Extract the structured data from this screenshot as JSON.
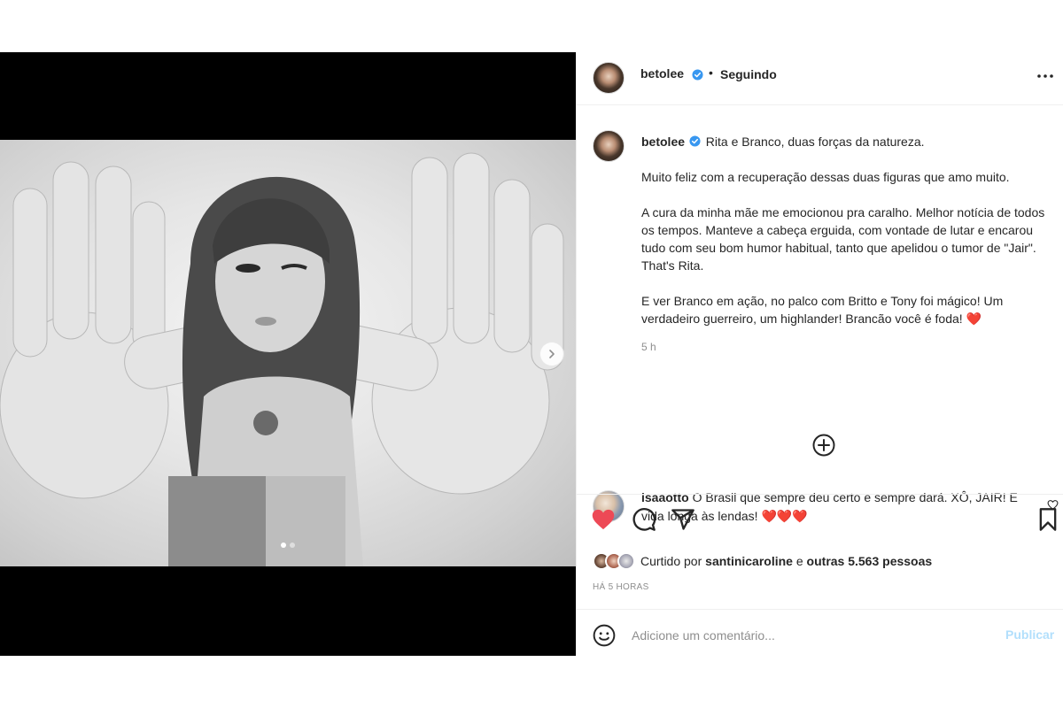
{
  "post": {
    "author": {
      "username": "betolee",
      "verified": true,
      "follow_separator": "•",
      "follow_status": "Seguindo"
    },
    "caption": {
      "headline": "Rita e Branco, duas forças da natureza.",
      "paragraphs": [
        "Muito feliz com a recuperação dessas duas figuras que amo muito.",
        "A cura da minha mãe me emocionou pra caralho. Melhor notícia de todos os tempos. Manteve a cabeça erguida, com vontade de lutar e encarou tudo com seu bom humor habitual, tanto que apelidou o tumor de \"Jair\". That's Rita.",
        "E ver Branco em ação, no palco com Britto e Tony foi mágico! Um verdadeiro guerreiro, um highlander! Brancão você é foda!"
      ],
      "heart_emoji": "❤️",
      "time_ago": "5 h"
    },
    "comments": [
      {
        "username": "isaaotto",
        "text": "O Brasil que sempre deu certo e sempre dará. XÔ, JAIR! E vida longa às lendas!",
        "emojis": "❤️❤️❤️"
      }
    ],
    "likes": {
      "prefix": "Curtido por",
      "first_user": "santinicaroline",
      "conjunction": "e",
      "others": "outras 5.563 pessoas"
    },
    "posted": "Há 5 horas",
    "add_comment": {
      "placeholder": "Adicione um comentário...",
      "publish_label": "Publicar"
    },
    "carousel": {
      "count": 2,
      "active_index": 0
    }
  },
  "icons": {
    "more": "more-horizontal-icon",
    "verified": "verified-badge-icon",
    "load_more": "plus-circle-icon",
    "like": "heart-filled-icon",
    "comment": "comment-bubble-icon",
    "share": "paper-plane-icon",
    "save": "bookmark-icon",
    "emoji": "emoji-smile-icon",
    "next": "chevron-right-icon"
  },
  "colors": {
    "like_red": "#ed4956",
    "verified_blue": "#3897f0",
    "publish_disabled": "#b2dffc",
    "muted_text": "#8e8e8e"
  }
}
